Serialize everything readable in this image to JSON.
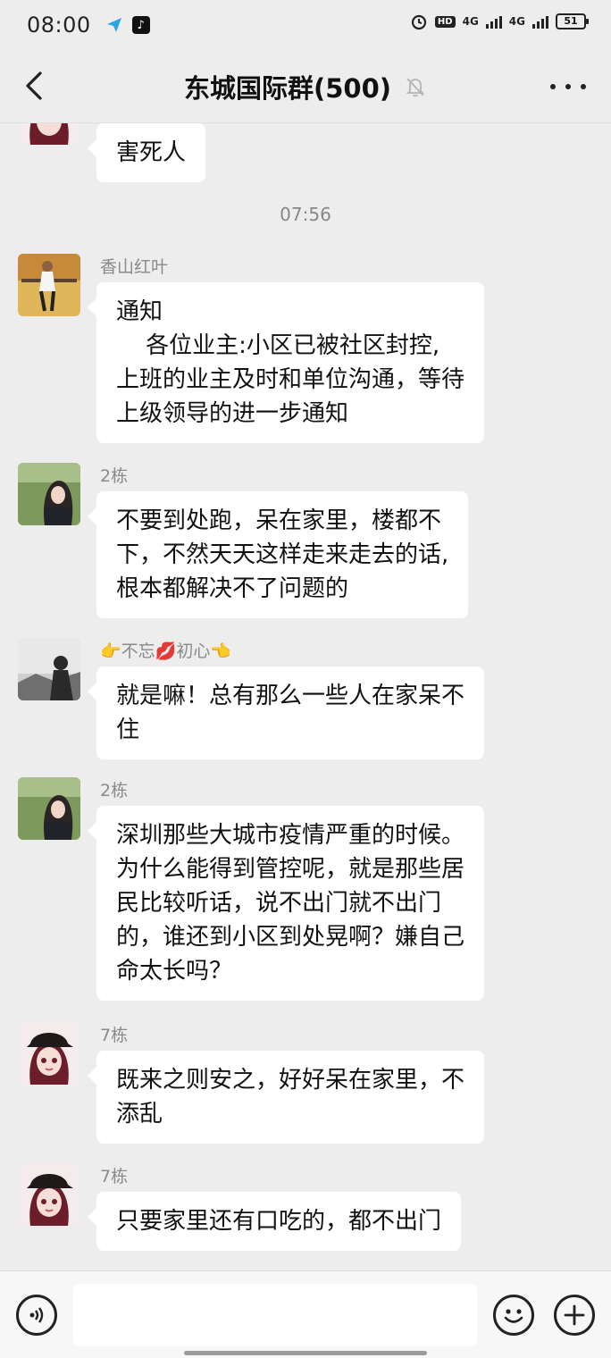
{
  "status_bar": {
    "time": "08:00",
    "hd": "HD",
    "net1": "4G",
    "net2": "4G",
    "battery": "51"
  },
  "header": {
    "back_icon": "chevron-left-icon",
    "title": "东城国际群(500)",
    "mute_icon": "bell-off-icon",
    "more_icon": "more-dots-icon"
  },
  "chat": {
    "top_partial_message": "害死人",
    "timestamp": "07:56",
    "messages": [
      {
        "sender": "香山红叶",
        "text": "通知\n    各位业主:小区已被社区封控,\n上班的业主及时和单位沟通，等待\n上级领导的进一步通知"
      },
      {
        "sender": "2栋",
        "text": "不要到处跑，呆在家里，楼都不\n下，不然天天这样走来走去的话,\n根本都解决不了问题的"
      },
      {
        "sender": "👉不忘💋初心👈",
        "text": "就是嘛！总有那么一些人在家呆不\n住"
      },
      {
        "sender": "2栋",
        "text": "深圳那些大城市疫情严重的时候。\n为什么能得到管控呢，就是那些居\n民比较听话，说不出门就不出门\n的，谁还到小区到处晃啊？嫌自己\n命太长吗？"
      },
      {
        "sender": "7栋",
        "text": "既来之则安之，好好呆在家里，不\n添乱"
      },
      {
        "sender": "7栋",
        "text": "只要家里还有口吃的，都不出门"
      }
    ]
  },
  "input_bar": {
    "voice_icon": "voice-icon",
    "input_value": "",
    "emoji_icon": "emoji-icon",
    "plus_icon": "plus-icon"
  }
}
